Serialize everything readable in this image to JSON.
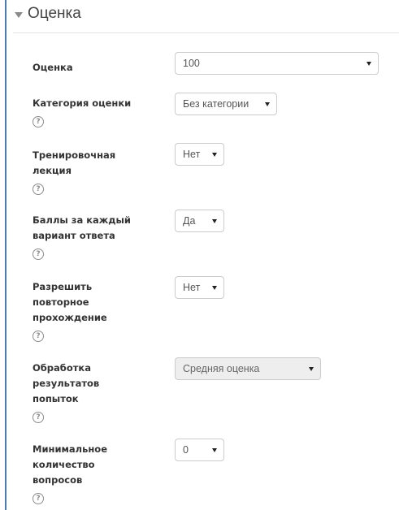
{
  "section": {
    "title": "Оценка"
  },
  "fields": [
    {
      "label": "Оценка",
      "value": "100"
    },
    {
      "label": "Категория оценки",
      "value": "Без категории"
    },
    {
      "label": "Тренировочная лекция",
      "value": "Нет"
    },
    {
      "label": "Баллы за каждый вариант ответа",
      "value": "Да"
    },
    {
      "label": "Разрешить повторное прохождение",
      "value": "Нет"
    },
    {
      "label": "Обработка результатов попыток",
      "value": "Средняя оценка"
    },
    {
      "label": "Минимальное количество вопросов",
      "value": "0"
    }
  ],
  "help_icon_glyph": "?"
}
